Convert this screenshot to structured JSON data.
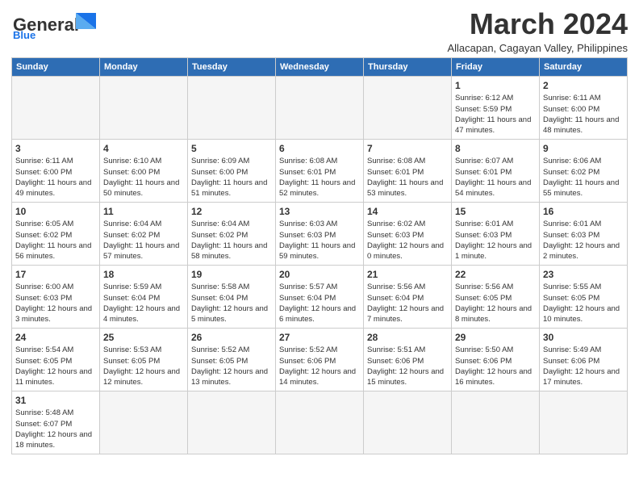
{
  "logo": {
    "text_general": "General",
    "text_blue": "Blue"
  },
  "title": "March 2024",
  "subtitle": "Allacapan, Cagayan Valley, Philippines",
  "days_header": [
    "Sunday",
    "Monday",
    "Tuesday",
    "Wednesday",
    "Thursday",
    "Friday",
    "Saturday"
  ],
  "weeks": [
    [
      {
        "day": "",
        "info": "",
        "empty": true
      },
      {
        "day": "",
        "info": "",
        "empty": true
      },
      {
        "day": "",
        "info": "",
        "empty": true
      },
      {
        "day": "",
        "info": "",
        "empty": true
      },
      {
        "day": "",
        "info": "",
        "empty": true
      },
      {
        "day": "1",
        "info": "Sunrise: 6:12 AM\nSunset: 5:59 PM\nDaylight: 11 hours and 47 minutes."
      },
      {
        "day": "2",
        "info": "Sunrise: 6:11 AM\nSunset: 6:00 PM\nDaylight: 11 hours and 48 minutes."
      }
    ],
    [
      {
        "day": "3",
        "info": "Sunrise: 6:11 AM\nSunset: 6:00 PM\nDaylight: 11 hours and 49 minutes."
      },
      {
        "day": "4",
        "info": "Sunrise: 6:10 AM\nSunset: 6:00 PM\nDaylight: 11 hours and 50 minutes."
      },
      {
        "day": "5",
        "info": "Sunrise: 6:09 AM\nSunset: 6:00 PM\nDaylight: 11 hours and 51 minutes."
      },
      {
        "day": "6",
        "info": "Sunrise: 6:08 AM\nSunset: 6:01 PM\nDaylight: 11 hours and 52 minutes."
      },
      {
        "day": "7",
        "info": "Sunrise: 6:08 AM\nSunset: 6:01 PM\nDaylight: 11 hours and 53 minutes."
      },
      {
        "day": "8",
        "info": "Sunrise: 6:07 AM\nSunset: 6:01 PM\nDaylight: 11 hours and 54 minutes."
      },
      {
        "day": "9",
        "info": "Sunrise: 6:06 AM\nSunset: 6:02 PM\nDaylight: 11 hours and 55 minutes."
      }
    ],
    [
      {
        "day": "10",
        "info": "Sunrise: 6:05 AM\nSunset: 6:02 PM\nDaylight: 11 hours and 56 minutes."
      },
      {
        "day": "11",
        "info": "Sunrise: 6:04 AM\nSunset: 6:02 PM\nDaylight: 11 hours and 57 minutes."
      },
      {
        "day": "12",
        "info": "Sunrise: 6:04 AM\nSunset: 6:02 PM\nDaylight: 11 hours and 58 minutes."
      },
      {
        "day": "13",
        "info": "Sunrise: 6:03 AM\nSunset: 6:03 PM\nDaylight: 11 hours and 59 minutes."
      },
      {
        "day": "14",
        "info": "Sunrise: 6:02 AM\nSunset: 6:03 PM\nDaylight: 12 hours and 0 minutes."
      },
      {
        "day": "15",
        "info": "Sunrise: 6:01 AM\nSunset: 6:03 PM\nDaylight: 12 hours and 1 minute."
      },
      {
        "day": "16",
        "info": "Sunrise: 6:01 AM\nSunset: 6:03 PM\nDaylight: 12 hours and 2 minutes."
      }
    ],
    [
      {
        "day": "17",
        "info": "Sunrise: 6:00 AM\nSunset: 6:03 PM\nDaylight: 12 hours and 3 minutes."
      },
      {
        "day": "18",
        "info": "Sunrise: 5:59 AM\nSunset: 6:04 PM\nDaylight: 12 hours and 4 minutes."
      },
      {
        "day": "19",
        "info": "Sunrise: 5:58 AM\nSunset: 6:04 PM\nDaylight: 12 hours and 5 minutes."
      },
      {
        "day": "20",
        "info": "Sunrise: 5:57 AM\nSunset: 6:04 PM\nDaylight: 12 hours and 6 minutes."
      },
      {
        "day": "21",
        "info": "Sunrise: 5:56 AM\nSunset: 6:04 PM\nDaylight: 12 hours and 7 minutes."
      },
      {
        "day": "22",
        "info": "Sunrise: 5:56 AM\nSunset: 6:05 PM\nDaylight: 12 hours and 8 minutes."
      },
      {
        "day": "23",
        "info": "Sunrise: 5:55 AM\nSunset: 6:05 PM\nDaylight: 12 hours and 10 minutes."
      }
    ],
    [
      {
        "day": "24",
        "info": "Sunrise: 5:54 AM\nSunset: 6:05 PM\nDaylight: 12 hours and 11 minutes."
      },
      {
        "day": "25",
        "info": "Sunrise: 5:53 AM\nSunset: 6:05 PM\nDaylight: 12 hours and 12 minutes."
      },
      {
        "day": "26",
        "info": "Sunrise: 5:52 AM\nSunset: 6:05 PM\nDaylight: 12 hours and 13 minutes."
      },
      {
        "day": "27",
        "info": "Sunrise: 5:52 AM\nSunset: 6:06 PM\nDaylight: 12 hours and 14 minutes."
      },
      {
        "day": "28",
        "info": "Sunrise: 5:51 AM\nSunset: 6:06 PM\nDaylight: 12 hours and 15 minutes."
      },
      {
        "day": "29",
        "info": "Sunrise: 5:50 AM\nSunset: 6:06 PM\nDaylight: 12 hours and 16 minutes."
      },
      {
        "day": "30",
        "info": "Sunrise: 5:49 AM\nSunset: 6:06 PM\nDaylight: 12 hours and 17 minutes."
      }
    ],
    [
      {
        "day": "31",
        "info": "Sunrise: 5:48 AM\nSunset: 6:07 PM\nDaylight: 12 hours and 18 minutes."
      },
      {
        "day": "",
        "info": "",
        "empty": true
      },
      {
        "day": "",
        "info": "",
        "empty": true
      },
      {
        "day": "",
        "info": "",
        "empty": true
      },
      {
        "day": "",
        "info": "",
        "empty": true
      },
      {
        "day": "",
        "info": "",
        "empty": true
      },
      {
        "day": "",
        "info": "",
        "empty": true
      }
    ]
  ]
}
